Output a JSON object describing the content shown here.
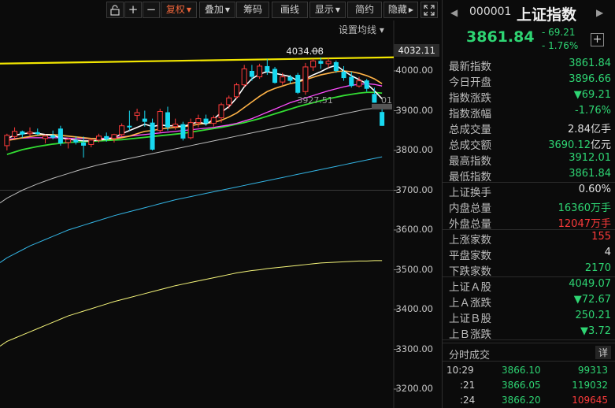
{
  "toolbar": {
    "lock_label": "⌂",
    "plus_label": "+",
    "minus_label": "−",
    "fuquan_label": "复权",
    "diejia_label": "叠加",
    "chouma_label": "筹码",
    "huaxian_label": "画线",
    "xianshi_label": "显示",
    "jiandan_label": "简约",
    "yincang_label": "隐藏",
    "expand_icon": "expand-icon",
    "colors": {
      "active": "#f0653a"
    }
  },
  "chart": {
    "ma_settings_label": "设置均线",
    "high_tag": "4032.11",
    "annotation_high": "4034.08",
    "annotation_low": "3927.51",
    "annotation_low_tail": "01",
    "y_ticks": [
      "4000.00",
      "3900.00",
      "3800.00",
      "3700.00",
      "3600.00",
      "3500.00",
      "3400.00",
      "3300.00",
      "3200.00"
    ],
    "colors": {
      "up": "#ff3b3b",
      "down": "#18d8f0",
      "ma5": "#ffffff",
      "ma10": "#ffb347",
      "ma20": "#ff4dff",
      "ma30": "#33dd33",
      "ma60": "#bbbbbb",
      "ma120": "#33b5e5",
      "ma250": "#f5f57a",
      "high_line": "#f2e600"
    }
  },
  "chart_data": {
    "type": "candlestick",
    "title": "",
    "xlabel": "",
    "ylabel": "",
    "ylim": [
      3180,
      4060
    ],
    "reference_line": 4032.11,
    "candles": [
      {
        "o": 3812,
        "h": 3842,
        "l": 3800,
        "c": 3838
      },
      {
        "o": 3835,
        "h": 3858,
        "l": 3830,
        "c": 3848
      },
      {
        "o": 3848,
        "h": 3850,
        "l": 3832,
        "c": 3840
      },
      {
        "o": 3842,
        "h": 3858,
        "l": 3836,
        "c": 3846
      },
      {
        "o": 3846,
        "h": 3855,
        "l": 3838,
        "c": 3841
      },
      {
        "o": 3830,
        "h": 3840,
        "l": 3818,
        "c": 3836
      },
      {
        "o": 3838,
        "h": 3850,
        "l": 3828,
        "c": 3832
      },
      {
        "o": 3855,
        "h": 3862,
        "l": 3812,
        "c": 3818
      },
      {
        "o": 3820,
        "h": 3832,
        "l": 3805,
        "c": 3828
      },
      {
        "o": 3826,
        "h": 3836,
        "l": 3815,
        "c": 3820
      },
      {
        "o": 3820,
        "h": 3835,
        "l": 3782,
        "c": 3812
      },
      {
        "o": 3815,
        "h": 3830,
        "l": 3808,
        "c": 3826
      },
      {
        "o": 3826,
        "h": 3842,
        "l": 3820,
        "c": 3836
      },
      {
        "o": 3836,
        "h": 3845,
        "l": 3822,
        "c": 3828
      },
      {
        "o": 3830,
        "h": 3842,
        "l": 3820,
        "c": 3840
      },
      {
        "o": 3840,
        "h": 3868,
        "l": 3835,
        "c": 3862
      },
      {
        "o": 3862,
        "h": 3900,
        "l": 3850,
        "c": 3858
      },
      {
        "o": 3888,
        "h": 3905,
        "l": 3875,
        "c": 3895
      },
      {
        "o": 3880,
        "h": 3900,
        "l": 3860,
        "c": 3872
      },
      {
        "o": 3870,
        "h": 3880,
        "l": 3800,
        "c": 3802
      },
      {
        "o": 3850,
        "h": 3905,
        "l": 3845,
        "c": 3898
      },
      {
        "o": 3896,
        "h": 3910,
        "l": 3850,
        "c": 3858
      },
      {
        "o": 3860,
        "h": 3880,
        "l": 3852,
        "c": 3866
      },
      {
        "o": 3866,
        "h": 3872,
        "l": 3825,
        "c": 3830
      },
      {
        "o": 3832,
        "h": 3880,
        "l": 3828,
        "c": 3870
      },
      {
        "o": 3870,
        "h": 3890,
        "l": 3858,
        "c": 3880
      },
      {
        "o": 3880,
        "h": 3890,
        "l": 3862,
        "c": 3868
      },
      {
        "o": 3868,
        "h": 3888,
        "l": 3860,
        "c": 3882
      },
      {
        "o": 3882,
        "h": 3920,
        "l": 3870,
        "c": 3915
      },
      {
        "o": 3915,
        "h": 3938,
        "l": 3905,
        "c": 3932
      },
      {
        "o": 3935,
        "h": 3970,
        "l": 3930,
        "c": 3965
      },
      {
        "o": 3965,
        "h": 4015,
        "l": 3960,
        "c": 4005
      },
      {
        "o": 4000,
        "h": 4015,
        "l": 3975,
        "c": 3985
      },
      {
        "o": 3985,
        "h": 4018,
        "l": 3980,
        "c": 4012
      },
      {
        "o": 4012,
        "h": 4030,
        "l": 3990,
        "c": 3998
      },
      {
        "o": 4005,
        "h": 4010,
        "l": 3968,
        "c": 3970
      },
      {
        "o": 3972,
        "h": 3995,
        "l": 3965,
        "c": 3985
      },
      {
        "o": 3985,
        "h": 3990,
        "l": 3968,
        "c": 3975
      },
      {
        "o": 3990,
        "h": 3995,
        "l": 3942,
        "c": 3945
      },
      {
        "o": 3948,
        "h": 4020,
        "l": 3940,
        "c": 4010
      },
      {
        "o": 4010,
        "h": 4030,
        "l": 4000,
        "c": 4025
      },
      {
        "o": 4025,
        "h": 4034,
        "l": 4005,
        "c": 4018
      },
      {
        "o": 4018,
        "h": 4032,
        "l": 4008,
        "c": 4024
      },
      {
        "o": 4022,
        "h": 4026,
        "l": 3995,
        "c": 4000
      },
      {
        "o": 3998,
        "h": 4012,
        "l": 3975,
        "c": 3982
      },
      {
        "o": 3985,
        "h": 3998,
        "l": 3958,
        "c": 3962
      },
      {
        "o": 3962,
        "h": 3985,
        "l": 3958,
        "c": 3975
      },
      {
        "o": 3976,
        "h": 3980,
        "l": 3948,
        "c": 3955
      },
      {
        "o": 3942,
        "h": 3958,
        "l": 3920,
        "c": 3920
      },
      {
        "o": 3896.66,
        "h": 3912.01,
        "l": 3861.84,
        "c": 3861.84
      }
    ],
    "ma5": [
      3830,
      3838,
      3842,
      3844,
      3843,
      3840,
      3838,
      3832,
      3828,
      3826,
      3824,
      3824,
      3826,
      3828,
      3832,
      3842,
      3850,
      3858,
      3866,
      3860,
      3864,
      3862,
      3862,
      3860,
      3866,
      3872,
      3866,
      3878,
      3896,
      3910,
      3932,
      3960,
      3980,
      3992,
      3998,
      3994,
      3990,
      3986,
      3975,
      3980,
      3990,
      3998,
      4008,
      4014,
      4000,
      3988,
      3978,
      3968,
      3950,
      3930
    ],
    "ma10": [
      3825,
      3828,
      3832,
      3835,
      3838,
      3840,
      3840,
      3838,
      3836,
      3834,
      3832,
      3830,
      3829,
      3828,
      3829,
      3832,
      3836,
      3842,
      3848,
      3850,
      3854,
      3856,
      3858,
      3860,
      3862,
      3866,
      3868,
      3870,
      3876,
      3884,
      3894,
      3908,
      3922,
      3936,
      3948,
      3956,
      3962,
      3968,
      3972,
      3978,
      3984,
      3990,
      3994,
      3998,
      4000,
      3998,
      3994,
      3988,
      3980,
      3968
    ],
    "ma20": [
      3828,
      3830,
      3831,
      3832,
      3832,
      3832,
      3832,
      3832,
      3831,
      3830,
      3830,
      3830,
      3830,
      3831,
      3832,
      3834,
      3836,
      3838,
      3840,
      3842,
      3844,
      3846,
      3848,
      3850,
      3852,
      3854,
      3856,
      3858,
      3861,
      3864,
      3868,
      3874,
      3880,
      3888,
      3896,
      3904,
      3912,
      3920,
      3926,
      3932,
      3938,
      3944,
      3950,
      3955,
      3960,
      3964,
      3966,
      3968,
      3966,
      3962
    ],
    "ma30": [
      3790,
      3796,
      3802,
      3806,
      3810,
      3813,
      3816,
      3818,
      3820,
      3821,
      3822,
      3823,
      3824,
      3825,
      3826,
      3827,
      3829,
      3831,
      3833,
      3835,
      3837,
      3839,
      3841,
      3843,
      3846,
      3849,
      3852,
      3855,
      3858,
      3862,
      3866,
      3870,
      3875,
      3880,
      3886,
      3892,
      3898,
      3904,
      3910,
      3915,
      3920,
      3925,
      3930,
      3934,
      3938,
      3941,
      3944,
      3946,
      3946,
      3944
    ],
    "ma60": [
      3680,
      3690,
      3700,
      3708,
      3716,
      3723,
      3730,
      3736,
      3742,
      3748,
      3754,
      3759,
      3764,
      3768,
      3772,
      3776,
      3780,
      3784,
      3788,
      3792,
      3796,
      3800,
      3804,
      3808,
      3812,
      3816,
      3820,
      3824,
      3828,
      3832,
      3836,
      3840,
      3844,
      3848,
      3852,
      3856,
      3860,
      3864,
      3868,
      3872,
      3876,
      3880,
      3884,
      3888,
      3892,
      3896,
      3900,
      3904,
      3906,
      3907
    ],
    "ma120": [
      3530,
      3540,
      3550,
      3560,
      3568,
      3576,
      3584,
      3592,
      3600,
      3606,
      3612,
      3618,
      3624,
      3630,
      3636,
      3641,
      3646,
      3651,
      3656,
      3661,
      3666,
      3671,
      3676,
      3680,
      3684,
      3688,
      3692,
      3696,
      3700,
      3704,
      3708,
      3712,
      3716,
      3720,
      3724,
      3728,
      3732,
      3736,
      3740,
      3744,
      3748,
      3752,
      3756,
      3760,
      3764,
      3768,
      3772,
      3776,
      3780,
      3784
    ],
    "ma250": [
      3320,
      3328,
      3336,
      3344,
      3352,
      3360,
      3368,
      3376,
      3384,
      3390,
      3396,
      3402,
      3408,
      3414,
      3420,
      3425,
      3430,
      3435,
      3440,
      3445,
      3450,
      3455,
      3460,
      3464,
      3468,
      3472,
      3476,
      3480,
      3484,
      3488,
      3492,
      3495,
      3498,
      3500,
      3503,
      3505,
      3507,
      3509,
      3511,
      3513,
      3515,
      3517,
      3518,
      3519,
      3520,
      3521,
      3522,
      3522,
      3523,
      3523
    ]
  },
  "panel": {
    "code": "000001",
    "name": "上证指数",
    "price": "3861.84",
    "change": "- 69.21",
    "change_pct": "- 1.76%",
    "add_label": "+",
    "nav_left": "◀",
    "nav_right": "▶",
    "stats": [
      {
        "label": "最新指数",
        "value": "3861.84",
        "color": "green"
      },
      {
        "label": "今日开盘",
        "value": "3896.66",
        "color": "green"
      },
      {
        "label": "指数涨跌",
        "value": "▼69.21",
        "color": "green"
      },
      {
        "label": "指数涨幅",
        "value": "-1.76%",
        "color": "green"
      },
      {
        "label": "总成交量",
        "value": "2.84亿手",
        "color": "white"
      },
      {
        "label": "总成交额",
        "value": "3690.12亿元",
        "color": "mixed"
      },
      {
        "label": "最高指数",
        "value": "3912.01",
        "color": "green"
      },
      {
        "label": "最低指数",
        "value": "3861.84",
        "color": "green"
      },
      {
        "label": "上证换手",
        "value": "0.60%",
        "color": "white"
      },
      {
        "label": "内盘总量",
        "value": "16360万手",
        "color": "green"
      },
      {
        "label": "外盘总量",
        "value": "12047万手",
        "color": "red"
      },
      {
        "label": "上涨家数",
        "value": "155",
        "color": "red"
      },
      {
        "label": "平盘家数",
        "value": "4",
        "color": "white"
      },
      {
        "label": "下跌家数",
        "value": "2170",
        "color": "green"
      },
      {
        "label": "上证Ａ股",
        "value": "4049.07",
        "color": "green"
      },
      {
        "label": "上Ａ涨跌",
        "value": "▼72.67",
        "color": "green"
      },
      {
        "label": "上证Ｂ股",
        "value": "250.21",
        "color": "green"
      },
      {
        "label": "上Ｂ涨跌",
        "value": "▼3.72",
        "color": "green"
      }
    ],
    "trades_title": "分时成交",
    "detail_label": "详",
    "trades": [
      {
        "time": "10:29",
        "price": "3866.10",
        "volume": "99313",
        "color": "green"
      },
      {
        "time": ":21",
        "price": "3866.05",
        "volume": "119032",
        "color": "green"
      },
      {
        "time": ":24",
        "price": "3866.20",
        "volume": "109645",
        "color": "red"
      }
    ]
  }
}
